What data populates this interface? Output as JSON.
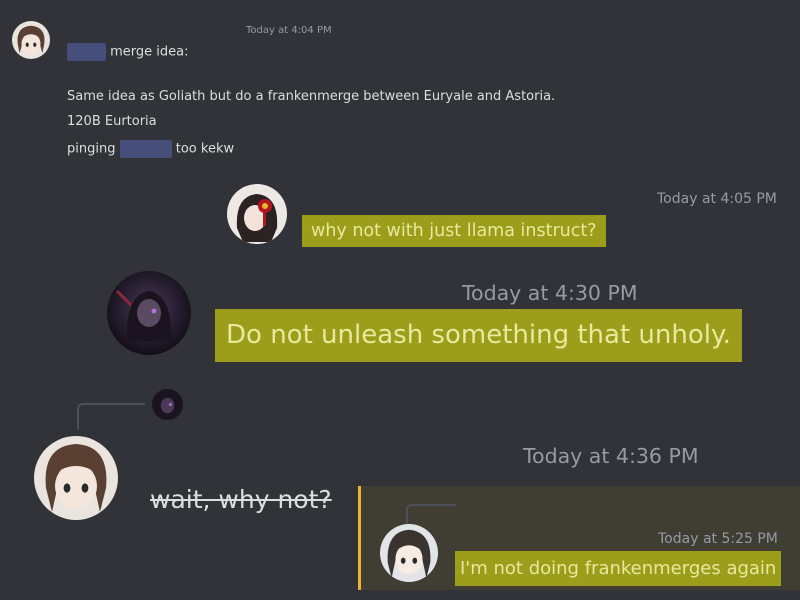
{
  "messages": {
    "m1": {
      "timestamp": "Today at 4:04 PM",
      "line1_suffix": "merge idea:",
      "line2": "Same idea as Goliath but do a frankenmerge between Euryale and Astoria.",
      "line3": "120B Eurtoria",
      "line4_prefix": "pinging",
      "line4_suffix": "too kekw"
    },
    "m2": {
      "timestamp": "Today at 4:05 PM",
      "text": "why not with just llama instruct?"
    },
    "m3": {
      "timestamp": "Today at 4:30 PM",
      "text": "Do not unleash something that unholy."
    },
    "m4": {
      "timestamp": "Today at 4:36 PM",
      "text": "wait, why not?"
    },
    "m5": {
      "timestamp": "Today at 5:25 PM",
      "text": "I'm not doing frankenmerges again"
    }
  },
  "colors": {
    "background": "#313338",
    "highlight": "#9d9d1c",
    "highlight_text": "#e8e99a",
    "quote_border": "#f0b232",
    "redaction": "#5865b2"
  }
}
